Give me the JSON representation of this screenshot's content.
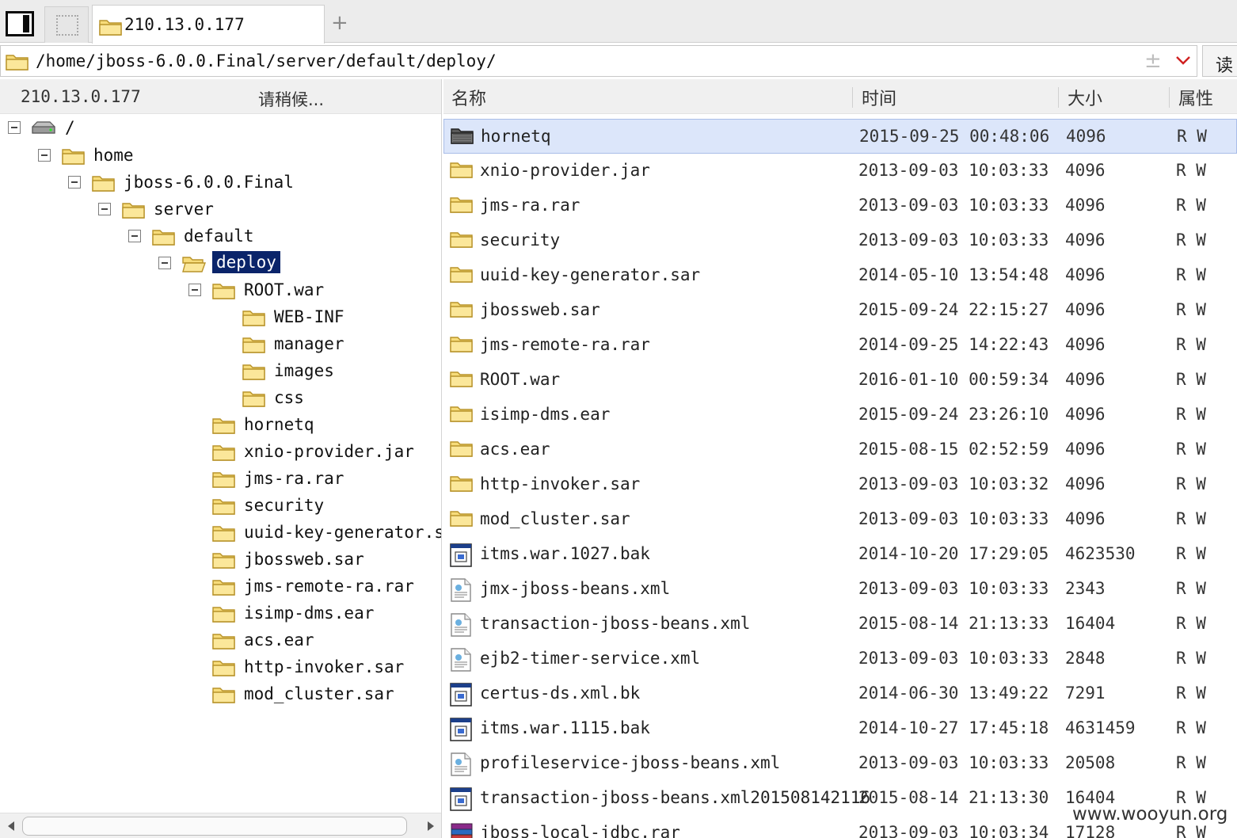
{
  "tabs": {
    "active_tab_label": "210.13.0.177",
    "add_tab_label": "+"
  },
  "address_bar": {
    "path": "/home/jboss-6.0.0.Final/server/default/deploy/",
    "right_button_label": "读"
  },
  "left_pane": {
    "host": "210.13.0.177",
    "status": "请稍候...",
    "tree": [
      {
        "label": "/",
        "type": "drive"
      },
      {
        "label": "home",
        "type": "folder"
      },
      {
        "label": "jboss-6.0.0.Final",
        "type": "folder"
      },
      {
        "label": "server",
        "type": "folder"
      },
      {
        "label": "default",
        "type": "folder"
      },
      {
        "label": "deploy",
        "type": "folder-open",
        "selected": true
      },
      {
        "label": "ROOT.war",
        "type": "folder"
      },
      {
        "label": "WEB-INF",
        "type": "folder"
      },
      {
        "label": "manager",
        "type": "folder"
      },
      {
        "label": "images",
        "type": "folder"
      },
      {
        "label": "css",
        "type": "folder"
      },
      {
        "label": "hornetq",
        "type": "folder"
      },
      {
        "label": "xnio-provider.jar",
        "type": "folder"
      },
      {
        "label": "jms-ra.rar",
        "type": "folder"
      },
      {
        "label": "security",
        "type": "folder"
      },
      {
        "label": "uuid-key-generator.sa",
        "type": "folder"
      },
      {
        "label": "jbossweb.sar",
        "type": "folder"
      },
      {
        "label": "jms-remote-ra.rar",
        "type": "folder"
      },
      {
        "label": "isimp-dms.ear",
        "type": "folder"
      },
      {
        "label": "acs.ear",
        "type": "folder"
      },
      {
        "label": "http-invoker.sar",
        "type": "folder"
      },
      {
        "label": "mod_cluster.sar",
        "type": "folder"
      }
    ]
  },
  "file_list": {
    "columns": {
      "name": "名称",
      "time": "时间",
      "size": "大小",
      "attr": "属性"
    },
    "rows": [
      {
        "name": "hornetq",
        "time": "2015-09-25 00:48:06",
        "size": "4096",
        "attr": "R W",
        "icon": "folder-dark-icon",
        "selected": true
      },
      {
        "name": "xnio-provider.jar",
        "time": "2013-09-03 10:03:33",
        "size": "4096",
        "attr": "R W",
        "icon": "folder-icon"
      },
      {
        "name": "jms-ra.rar",
        "time": "2013-09-03 10:03:33",
        "size": "4096",
        "attr": "R W",
        "icon": "folder-icon"
      },
      {
        "name": "security",
        "time": "2013-09-03 10:03:33",
        "size": "4096",
        "attr": "R W",
        "icon": "folder-icon"
      },
      {
        "name": "uuid-key-generator.sar",
        "time": "2014-05-10 13:54:48",
        "size": "4096",
        "attr": "R W",
        "icon": "folder-icon"
      },
      {
        "name": "jbossweb.sar",
        "time": "2015-09-24 22:15:27",
        "size": "4096",
        "attr": "R W",
        "icon": "folder-icon"
      },
      {
        "name": "jms-remote-ra.rar",
        "time": "2014-09-25 14:22:43",
        "size": "4096",
        "attr": "R W",
        "icon": "folder-icon"
      },
      {
        "name": "ROOT.war",
        "time": "2016-01-10 00:59:34",
        "size": "4096",
        "attr": "R W",
        "icon": "folder-icon"
      },
      {
        "name": "isimp-dms.ear",
        "time": "2015-09-24 23:26:10",
        "size": "4096",
        "attr": "R W",
        "icon": "folder-icon"
      },
      {
        "name": "acs.ear",
        "time": "2015-08-15 02:52:59",
        "size": "4096",
        "attr": "R W",
        "icon": "folder-icon"
      },
      {
        "name": "http-invoker.sar",
        "time": "2013-09-03 10:03:32",
        "size": "4096",
        "attr": "R W",
        "icon": "folder-icon"
      },
      {
        "name": "mod_cluster.sar",
        "time": "2013-09-03 10:03:33",
        "size": "4096",
        "attr": "R W",
        "icon": "folder-icon"
      },
      {
        "name": "itms.war.1027.bak",
        "time": "2014-10-20 17:29:05",
        "size": "4623530",
        "attr": "R W",
        "icon": "binary-file-icon"
      },
      {
        "name": "jmx-jboss-beans.xml",
        "time": "2013-09-03 10:03:33",
        "size": "2343",
        "attr": "R W",
        "icon": "xml-file-icon"
      },
      {
        "name": "transaction-jboss-beans.xml",
        "time": "2015-08-14 21:13:33",
        "size": "16404",
        "attr": "R W",
        "icon": "xml-file-icon"
      },
      {
        "name": "ejb2-timer-service.xml",
        "time": "2013-09-03 10:03:33",
        "size": "2848",
        "attr": "R W",
        "icon": "xml-file-icon"
      },
      {
        "name": "certus-ds.xml.bk",
        "time": "2014-06-30 13:49:22",
        "size": "7291",
        "attr": "R W",
        "icon": "binary-file-icon"
      },
      {
        "name": "itms.war.1115.bak",
        "time": "2014-10-27 17:45:18",
        "size": "4631459",
        "attr": "R W",
        "icon": "binary-file-icon"
      },
      {
        "name": "profileservice-jboss-beans.xml",
        "time": "2013-09-03 10:03:33",
        "size": "20508",
        "attr": "R W",
        "icon": "xml-file-icon"
      },
      {
        "name": "transaction-jboss-beans.xml201508142116",
        "time": "2015-08-14 21:13:30",
        "size": "16404",
        "attr": "R W",
        "icon": "binary-file-icon"
      },
      {
        "name": "jboss-local-jdbc.rar",
        "time": "2013-09-03 10:03:34",
        "size": "17128",
        "attr": "R W",
        "icon": "rar-file-icon"
      }
    ]
  },
  "watermark": "www.wooyun.org",
  "colors": {
    "selection_highlight": "#0a246a",
    "row_selected": "#dce6fa",
    "folder_yellow": "#f5d36b"
  }
}
